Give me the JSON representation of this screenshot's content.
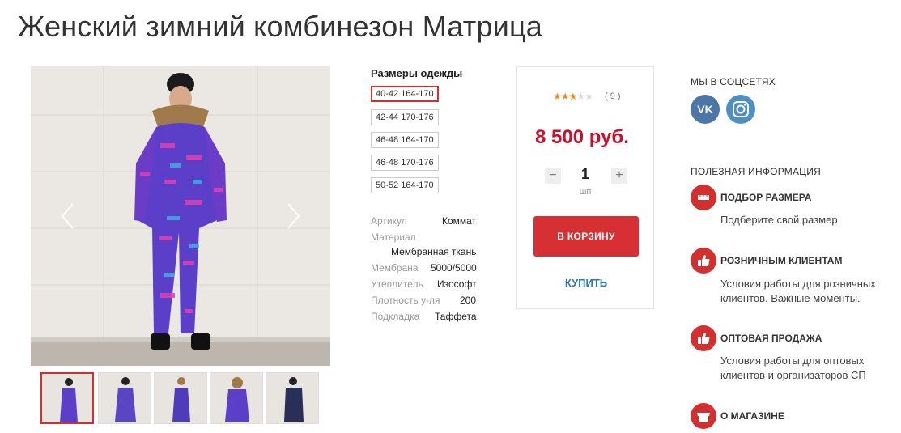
{
  "product": {
    "title": "Женский зимний комбинезон Матрица"
  },
  "gallery": {
    "prev_icon": "chevron-left-icon",
    "next_icon": "chevron-right-icon",
    "thumbnail_count": 5,
    "active_thumbnail": 1
  },
  "sizes": {
    "title": "Размеры одежды",
    "options": [
      "40-42 164-170",
      "42-44 170-176",
      "46-48 164-170",
      "46-48 170-176",
      "50-52 164-170"
    ],
    "selected": "40-42 164-170"
  },
  "specs": [
    {
      "key": "Артикул",
      "value": "Коммат"
    },
    {
      "key": "Материал",
      "value": "Мембранная ткань"
    },
    {
      "key": "Мембрана",
      "value": "5000/5000"
    },
    {
      "key": "Утеплитель",
      "value": "Изософт"
    },
    {
      "key": "Плотность у-ля",
      "value": "200"
    },
    {
      "key": "Подкладка",
      "value": "Таффета"
    }
  ],
  "buy": {
    "rating": 3,
    "rating_max": 5,
    "votes": "( 9 )",
    "price": "8 500 руб.",
    "qty_minus": "−",
    "qty_value": "1",
    "qty_plus": "+",
    "qty_unit": "шп",
    "cart_button": "В КОРЗИНУ",
    "buy_link": "КУПИТЬ"
  },
  "side": {
    "social_title": "МЫ В СОЦСЕТЯХ",
    "social": [
      {
        "name": "vk",
        "icon": "vk-icon",
        "label": "VK"
      },
      {
        "name": "instagram",
        "icon": "instagram-icon"
      }
    ],
    "info_title": "ПОЛЕЗНАЯ ИНФОРМАЦИЯ",
    "items": [
      {
        "title": "ПОДБОР РАЗМЕРА",
        "text": "Подберите свой размер",
        "icon": "ruler-icon"
      },
      {
        "title": "РОЗНИЧНЫМ КЛИЕНТАМ",
        "text": "Условия работы для розничных клиентов. Важные моменты.",
        "icon": "thumbs-up-icon"
      },
      {
        "title": "ОПТОВАЯ ПРОДАЖА",
        "text": "Условия работы для оптовых клиентов и организаторов СП",
        "icon": "thumbs-up-icon"
      },
      {
        "title": "О МАГАЗИНЕ",
        "text": "",
        "icon": "shop-icon"
      }
    ]
  },
  "colors": {
    "accent_red": "#d32f2f",
    "cart_red": "#d63035",
    "price_red": "#c8102e",
    "link_blue": "#2a7ab6",
    "vk_blue": "#4a76a8"
  }
}
